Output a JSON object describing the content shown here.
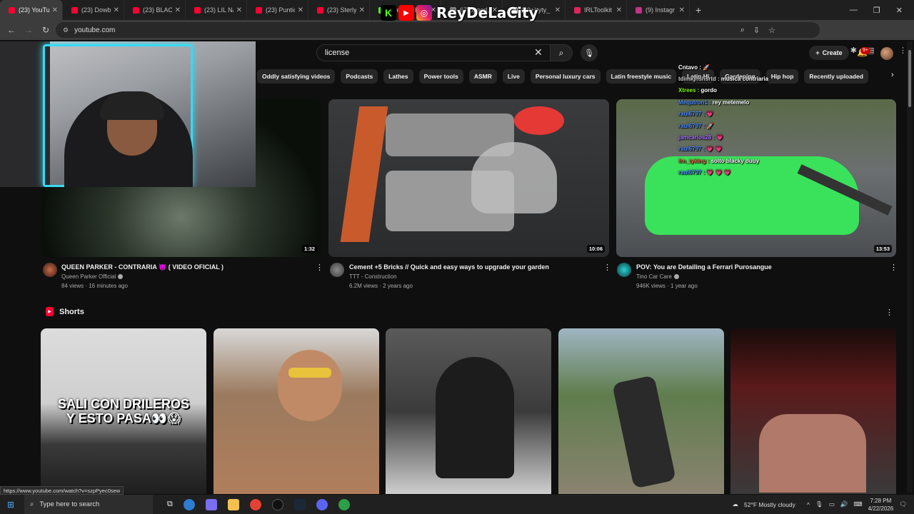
{
  "browser": {
    "tabs": [
      {
        "label": "(23) YouTube",
        "color": "#ff0033",
        "active": true
      },
      {
        "label": "(23) Dowb",
        "color": "#ff0033"
      },
      {
        "label": "(23) BLACK",
        "color": "#ff0033"
      },
      {
        "label": "(23) LIL NA",
        "color": "#ff0033"
      },
      {
        "label": "(23) Puntic",
        "color": "#ff0033"
      },
      {
        "label": "(23) Sterly",
        "color": "#ff0033"
      },
      {
        "label": "Stream - K",
        "color": "#53fc18"
      },
      {
        "label": "67 Speed,",
        "color": "#888888"
      },
      {
        "label": "(99+)tyty_",
        "color": "#ffffff"
      },
      {
        "label": "IRLToolkit",
        "color": "#e0245e"
      },
      {
        "label": "(9) Instagr",
        "color": "#c13584"
      }
    ],
    "new_tab": "+",
    "address": "youtube.com"
  },
  "overlay": {
    "brand_name": "ReyDeLaCity",
    "kick_letter": "K"
  },
  "youtube": {
    "search": {
      "value": "license",
      "clear": "✕"
    },
    "create_label": "Create",
    "notifications_badge": "9+",
    "chips": [
      "Oddly satisfying videos",
      "Podcasts",
      "Lathes",
      "Power tools",
      "ASMR",
      "Live",
      "Personal luxury cars",
      "Latin freestyle music",
      "Latin Hi",
      "Gardening",
      "Hip hop",
      "Recently uploaded"
    ],
    "videos": [
      {
        "title": "QUEEN PARKER - CONTRARIA 👿 ( VIDEO OFICIAL )",
        "channel": "Queen Parker Official",
        "meta": "84 views · 16 minutes ago",
        "duration": "1:32"
      },
      {
        "title": "Cement +5  Bricks // Quick and easy ways to upgrade your garden",
        "channel": "TTT - Construction",
        "meta": "6.2M views · 2 years ago",
        "duration": "10:06"
      },
      {
        "title": "POV: You are Detailing a Ferrari Purosangue",
        "channel": "Tino Car Care",
        "meta": "946K views · 1 year ago",
        "duration": "13:53"
      }
    ],
    "shorts_title": "Shorts",
    "shorts": [
      {
        "caption": "SALI CON DRILEROS\nY ESTO PASA👀😱"
      },
      {
        "caption": ""
      },
      {
        "caption": ""
      },
      {
        "caption": ""
      },
      {
        "caption": ""
      }
    ]
  },
  "chat": [
    {
      "user": "Cntavo :",
      "msg": " 🚀",
      "color": "#ffffff"
    },
    {
      "user": "tdimkjhshsrtd :",
      "msg": "musica  contriaria",
      "color": "#cccccc"
    },
    {
      "user": "Xtrees :",
      "msg": "gordo",
      "color": "#7cfc00"
    },
    {
      "user": "Mequtron1 :",
      "msg": "rey metemelo",
      "color": "#4f8cff"
    },
    {
      "user": "raul6797 :",
      "msg": "💗",
      "color": "#4f8cff"
    },
    {
      "user": "raul6797 :",
      "msg": "🚀",
      "color": "#4f8cff"
    },
    {
      "user": "jamcarlos28 :",
      "msg": "💗",
      "color": "#a970ff"
    },
    {
      "user": "raul6797 :",
      "msg": "💗 💗",
      "color": "#4f8cff"
    },
    {
      "user": "frn_tyking :",
      "msg": "solto blacky  duuy",
      "color": "#ff6347"
    },
    {
      "user": "raul6797 :",
      "msg": "💗 💗 💗",
      "color": "#4f8cff"
    }
  ],
  "status_url": "https://www.youtube.com/watch?v=szpPyec0sew",
  "taskbar": {
    "search_placeholder": "Type here to search",
    "weather": "52°F  Mostly cloudy",
    "time": "7:28 PM",
    "date": "4/22/2026"
  }
}
